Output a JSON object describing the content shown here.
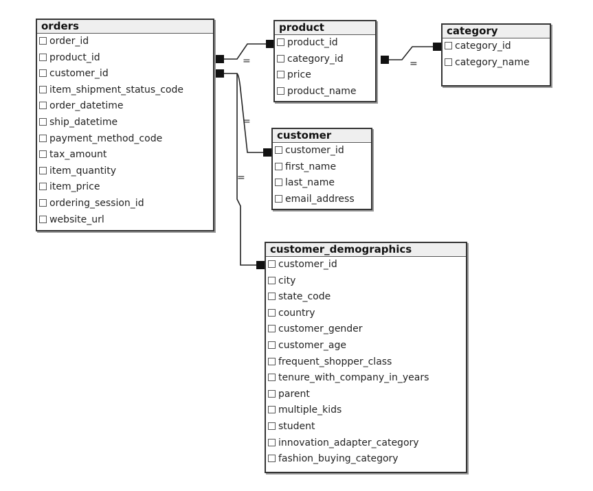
{
  "tables": {
    "orders": {
      "title": "orders",
      "columns": [
        "order_id",
        "product_id",
        "customer_id",
        "item_shipment_status_code",
        "order_datetime",
        "ship_datetime",
        "payment_method_code",
        "tax_amount",
        "item_quantity",
        "item_price",
        "ordering_session_id",
        "website_url"
      ]
    },
    "product": {
      "title": "product",
      "columns": [
        "product_id",
        "category_id",
        "price",
        "product_name"
      ]
    },
    "category": {
      "title": "category",
      "columns": [
        "category_id",
        "category_name"
      ]
    },
    "customer": {
      "title": "customer",
      "columns": [
        "customer_id",
        "first_name",
        "last_name",
        "email_address"
      ]
    },
    "customer_demographics": {
      "title": "customer_demographics",
      "columns": [
        "customer_id",
        "city",
        "state_code",
        "country",
        "customer_gender",
        "customer_age",
        "frequent_shopper_class",
        "tenure_with_company_in_years",
        "parent",
        "multiple_kids",
        "student",
        "innovation_adapter_category",
        "fashion_buying_category"
      ]
    }
  },
  "relationships": [
    {
      "from": "orders.product_id",
      "to": "product.product_id",
      "label": "="
    },
    {
      "from": "product.category_id",
      "to": "category.category_id",
      "label": "="
    },
    {
      "from": "orders.customer_id",
      "to": "customer.customer_id",
      "label": "="
    },
    {
      "from": "orders.customer_id",
      "to": "customer_demographics.customer_id",
      "label": "="
    }
  ]
}
